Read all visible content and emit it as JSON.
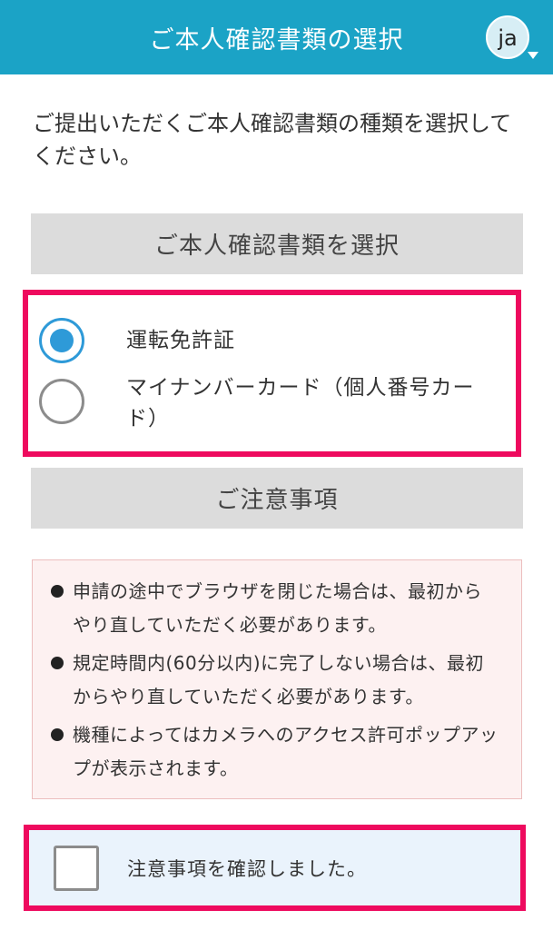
{
  "header": {
    "title": "ご本人確認書類の選択",
    "lang": "ja",
    "icons": [
      "language-globe-icon",
      "caret-down-icon"
    ]
  },
  "intro": "ご提出いただくご本人確認書類の種類を選択してください。",
  "doc_section_title": "ご本人確認書類を選択",
  "options": [
    {
      "label": "運転免許証",
      "selected": true
    },
    {
      "label": "マイナンバーカード（個人番号カード）",
      "selected": false
    }
  ],
  "notice_section_title": "ご注意事項",
  "notes": [
    "申請の途中でブラウザを閉じた場合は、最初からやり直していただく必要があります。",
    "規定時間内(60分以内)に完了しない場合は、最初からやり直していただく必要があります。",
    "機種によってはカメラへのアクセス許可ポップアップが表示されます。"
  ],
  "confirm": {
    "label": "注意事項を確認しました。",
    "checked": false
  },
  "colors": {
    "header_bg": "#1ba3c6",
    "highlight_border": "#ee0a5e",
    "radio_selected": "#2e9ad8",
    "notice_bg": "#fdf1f1",
    "confirm_bg": "#eaf3fc"
  }
}
